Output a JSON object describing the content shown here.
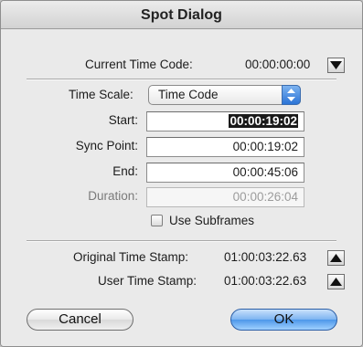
{
  "window": {
    "title": "Spot Dialog"
  },
  "current_time_code": {
    "label": "Current Time Code:",
    "value": "00:00:00:00"
  },
  "time_scale": {
    "label": "Time Scale:",
    "selected": "Time Code"
  },
  "fields": {
    "start": {
      "label": "Start:",
      "value": "00:00:19:02"
    },
    "sync_point": {
      "label": "Sync Point:",
      "value": "00:00:19:02"
    },
    "end": {
      "label": "End:",
      "value": "00:00:45:06"
    },
    "duration": {
      "label": "Duration:",
      "value": "00:00:26:04"
    }
  },
  "use_subframes": {
    "label": "Use Subframes",
    "checked": false
  },
  "original_time_stamp": {
    "label": "Original Time Stamp:",
    "value": "01:00:03:22.63"
  },
  "user_time_stamp": {
    "label": "User Time Stamp:",
    "value": "01:00:03:22.63"
  },
  "buttons": {
    "cancel": "Cancel",
    "ok": "OK"
  },
  "icons": {
    "current_time_code_button": "triangle-down-icon",
    "original_time_stamp_button": "triangle-up-icon",
    "user_time_stamp_button": "triangle-up-icon",
    "popup_stepper": "up-down-chevron-icon"
  }
}
